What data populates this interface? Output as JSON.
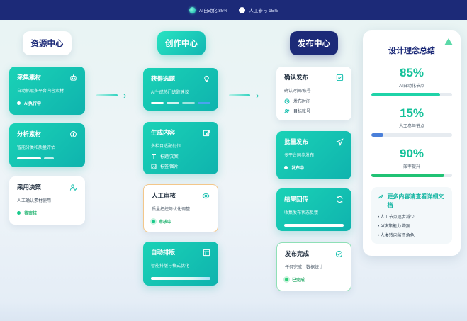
{
  "legend": {
    "ai_label": "AI自动化 85%",
    "human_label": "人工参与 15%"
  },
  "columns": {
    "resource": "资源中心",
    "creation": "创作中心",
    "publish": "发布中心"
  },
  "resource_cards": [
    {
      "title": "采集素材",
      "sub": "自动抓取多平台内容素材",
      "status": "AI执行中",
      "icon": "robot-icon"
    },
    {
      "title": "分析素材",
      "sub": "智能分类和质量评估",
      "icon": "analyze-icon"
    },
    {
      "title": "采用决策",
      "sub": "人工确认素材使用",
      "status": "待审核",
      "icon": "user-check-icon"
    }
  ],
  "creation_cards": [
    {
      "title": "获得选题",
      "sub": "AI生成热门选题建议",
      "icon": "bulb-icon"
    },
    {
      "title": "生成内容",
      "sub": "多栏目适配创作",
      "line1": "标题/文案",
      "line2": "标签/图片",
      "icon": "edit-icon"
    },
    {
      "title": "人工审核",
      "sub": "质量把控与优化调整",
      "status": "审核中",
      "icon": "eye-icon"
    },
    {
      "title": "自动排版",
      "sub": "智能排版与格式优化",
      "icon": "layout-icon"
    }
  ],
  "publish_cards": [
    {
      "title": "确认发布",
      "sub": "确认时间/账号",
      "line1": "发布时间",
      "line2": "目标账号",
      "icon": "checkbox-icon"
    },
    {
      "title": "批量发布",
      "sub": "多平台同步发布",
      "status": "发布中",
      "icon": "send-icon"
    },
    {
      "title": "结果回传",
      "sub": "收集发布状态反馈",
      "icon": "refresh-icon"
    },
    {
      "title": "发布完成",
      "sub": "任务完成，数据统计",
      "status": "已完成",
      "icon": "check-circle-icon"
    }
  ],
  "summary": {
    "title": "设计理念总结",
    "metrics": [
      {
        "value": "85%",
        "label": "AI自动化节点",
        "fill": 0.85,
        "color": "#1fd3a8"
      },
      {
        "value": "15%",
        "label": "人工参与节点",
        "fill": 0.15,
        "color": "#4a7fd9"
      },
      {
        "value": "90%",
        "label": "效率提升",
        "fill": 0.9,
        "color": "#20c274"
      }
    ],
    "more_title": "更多内容请查看详细文档",
    "more_items": [
      "人工节点逐步减少",
      "AI决策能力增强",
      "人类转向监督角色"
    ]
  },
  "colors": {
    "navy": "#1c2a78",
    "teal": "#14bfae",
    "accent_green": "#13c199"
  }
}
